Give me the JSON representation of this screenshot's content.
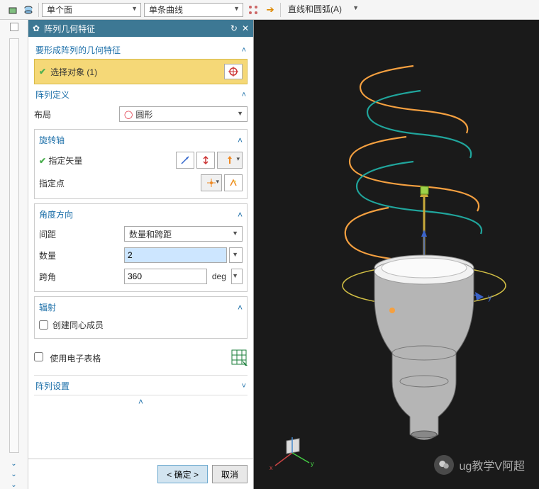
{
  "toolbar": {
    "face_mode": "单个面",
    "curve_mode": "单条曲线",
    "line_arc_label": "直线和圆弧(A)"
  },
  "panel": {
    "title": "阵列几何特征",
    "section_target": "要形成阵列的几何特征",
    "select_object_label": "选择对象 (1)",
    "section_define": "阵列定义",
    "layout_label": "布局",
    "layout_value": "圆形",
    "rot_axis_label": "旋转轴",
    "spec_vector_label": "指定矢量",
    "spec_point_label": "指定点",
    "angle_dir_label": "角度方向",
    "spacing_label": "间距",
    "spacing_value": "数量和跨距",
    "count_label": "数量",
    "count_value": "2",
    "span_label": "跨角",
    "span_value": "360",
    "span_unit": "deg",
    "radial_label": "辐射",
    "concentric_label": "创建同心成员",
    "spreadsheet_label": "使用电子表格",
    "pattern_settings_label": "阵列设置",
    "ok_label": "< 确定 >",
    "cancel_label": "取消"
  },
  "viewport": {
    "watermark": "ug教学V阿超",
    "axis_y": "y"
  }
}
